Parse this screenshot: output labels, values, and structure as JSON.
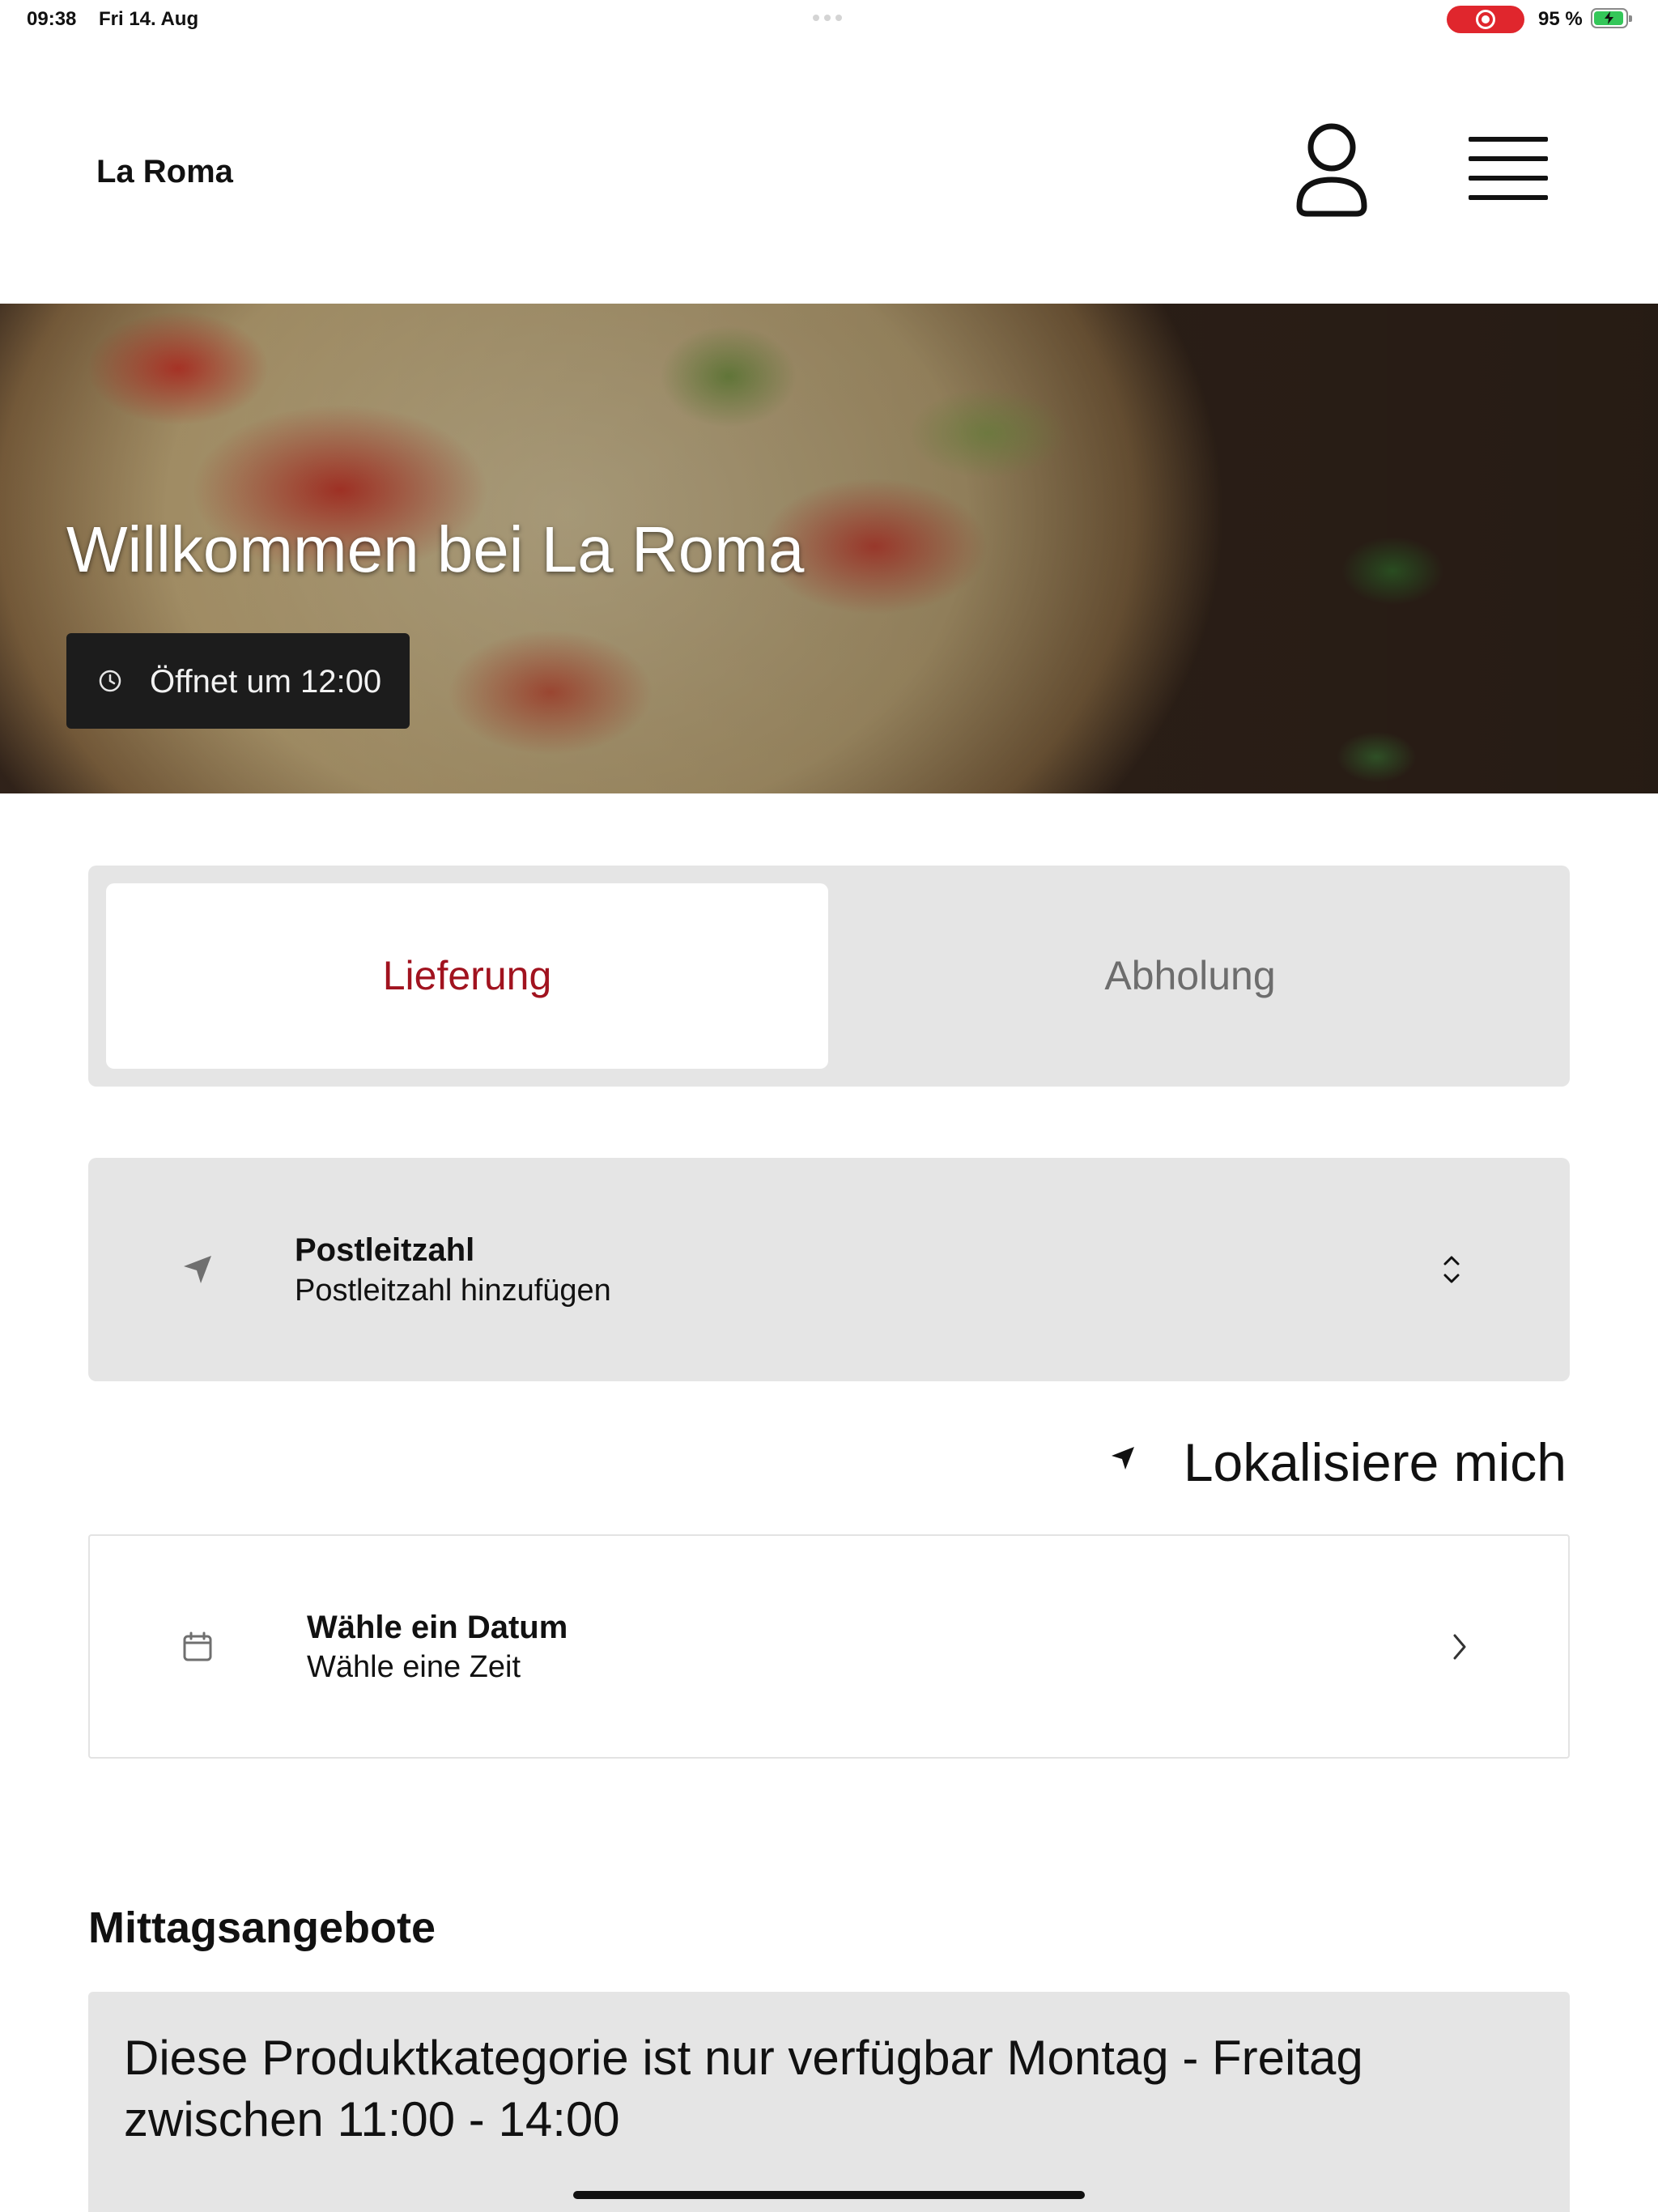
{
  "status_bar": {
    "time": "09:38",
    "date": "Fri 14. Aug",
    "battery_percent": "95 %",
    "battery_level": 0.95,
    "recording": true
  },
  "header": {
    "brand": "La Roma",
    "icons": [
      "user-icon",
      "hamburger-menu-icon"
    ]
  },
  "hero": {
    "title": "Willkommen bei La Roma",
    "opening_label": "Öffnet um 12:00"
  },
  "order_mode": {
    "tabs": [
      {
        "label": "Lieferung",
        "selected": true
      },
      {
        "label": "Abholung",
        "selected": false
      }
    ]
  },
  "postal": {
    "title": "Postleitzahl",
    "placeholder": "Postleitzahl hinzufügen"
  },
  "locate": {
    "label": "Lokalisiere mich"
  },
  "schedule": {
    "title": "Wähle ein Datum",
    "subtitle": "Wähle eine Zeit"
  },
  "section": {
    "title": "Mittagsangebote",
    "notice": "Diese Produktkategorie ist nur verfügbar Montag - Freitag zwischen 11:00 - 14:00"
  },
  "colors": {
    "accent": "#a1131f",
    "segment_bg": "#e5e5e5",
    "badge_bg": "#1c1c1c",
    "recording": "#e0262d",
    "battery": "#34c759"
  }
}
